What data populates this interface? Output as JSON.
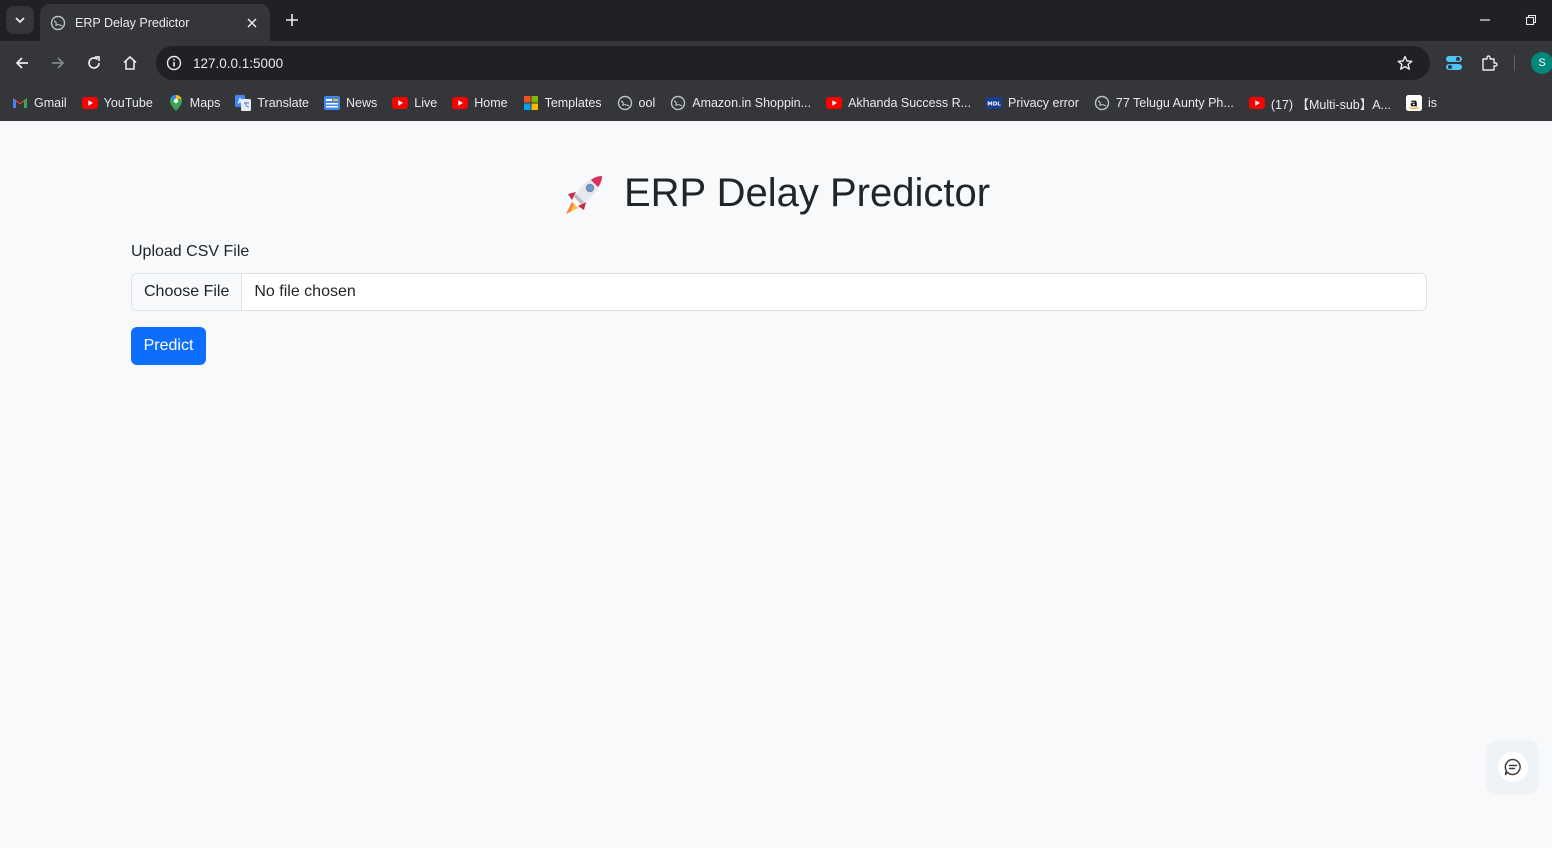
{
  "browser": {
    "tab_title": "ERP Delay Predictor",
    "url": "127.0.0.1:5000",
    "profile_initial": "S",
    "bookmarks": [
      {
        "label": "Gmail",
        "icon": "gmail-icon"
      },
      {
        "label": "YouTube",
        "icon": "youtube-icon"
      },
      {
        "label": "Maps",
        "icon": "maps-icon"
      },
      {
        "label": "Translate",
        "icon": "translate-icon"
      },
      {
        "label": "News",
        "icon": "news-icon"
      },
      {
        "label": "Live",
        "icon": "youtube-icon"
      },
      {
        "label": "Home",
        "icon": "youtube-icon"
      },
      {
        "label": "Templates",
        "icon": "microsoft-icon"
      },
      {
        "label": "ool",
        "icon": "globe-icon"
      },
      {
        "label": "Amazon.in Shoppin...",
        "icon": "globe-icon"
      },
      {
        "label": "Akhanda Success R...",
        "icon": "youtube-icon"
      },
      {
        "label": "Privacy error",
        "icon": "mdl-icon"
      },
      {
        "label": "77 Telugu Aunty Ph...",
        "icon": "globe-icon"
      },
      {
        "label": "(17) 【Multi-sub】A...",
        "icon": "youtube-icon"
      },
      {
        "label": "is",
        "icon": "amazon-icon"
      }
    ]
  },
  "page": {
    "title": "ERP Delay Predictor",
    "title_icon": "rocket-icon",
    "upload_label": "Upload CSV File",
    "choose_file_label": "Choose File",
    "file_status": "No file chosen",
    "predict_label": "Predict"
  },
  "colors": {
    "primary_button": "#0d6efd",
    "page_background": "#f8f9fa",
    "chrome_dark": "#202124",
    "chrome_toolbar": "#35363a"
  }
}
